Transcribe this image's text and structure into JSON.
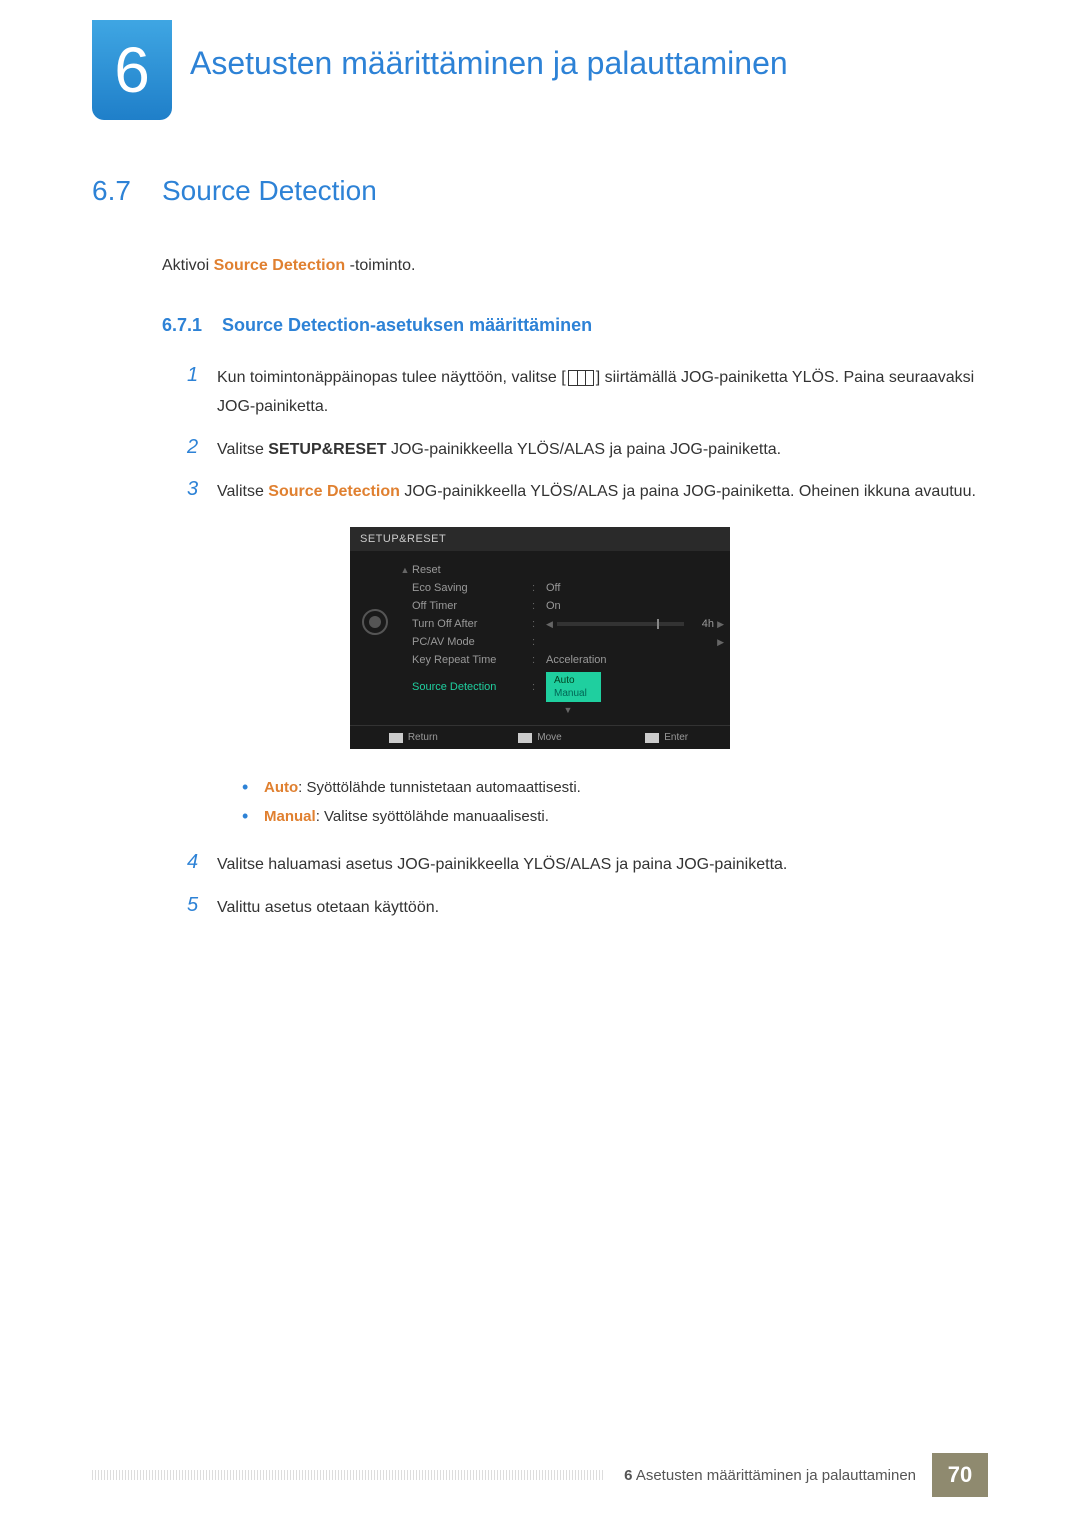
{
  "header": {
    "chapter_number": "6",
    "chapter_title": "Asetusten määrittäminen ja palauttaminen"
  },
  "section": {
    "number": "6.7",
    "title": "Source Detection",
    "intro_prefix": "Aktivoi ",
    "intro_bold": "Source Detection",
    "intro_suffix": " -toiminto."
  },
  "subsection": {
    "number": "6.7.1",
    "title": "Source Detection-asetuksen määrittäminen"
  },
  "steps": {
    "s1": {
      "num": "1",
      "t1": "Kun toimintonäppäinopas tulee näyttöön, valitse [",
      "t2": "] siirtämällä JOG-painiketta YLÖS. Paina seuraavaksi JOG-painiketta."
    },
    "s2": {
      "num": "2",
      "t1": "Valitse ",
      "b1": "SETUP&RESET",
      "t2": " JOG-painikkeella YLÖS/ALAS ja paina JOG-painiketta."
    },
    "s3": {
      "num": "3",
      "t1": "Valitse ",
      "b1": "Source Detection",
      "t2": " JOG-painikkeella YLÖS/ALAS ja paina JOG-painiketta. Oheinen ikkuna avautuu."
    },
    "s4": {
      "num": "4",
      "t": "Valitse haluamasi asetus JOG-painikkeella YLÖS/ALAS ja paina JOG-painiketta."
    },
    "s5": {
      "num": "5",
      "t": "Valittu asetus otetaan käyttöön."
    }
  },
  "osd": {
    "title": "SETUP&RESET",
    "rows": {
      "reset": "Reset",
      "eco": "Eco Saving",
      "eco_val": "Off",
      "timer": "Off Timer",
      "timer_val": "On",
      "turnoff": "Turn Off After",
      "turnoff_val": "4h",
      "pcav": "PC/AV Mode",
      "repeat": "Key Repeat Time",
      "repeat_val": "Acceleration",
      "source": "Source Detection",
      "source_auto": "Auto",
      "source_manual": "Manual"
    },
    "footer": {
      "return": "Return",
      "move": "Move",
      "enter": "Enter"
    }
  },
  "bullets": {
    "b1_label": "Auto",
    "b1_text": ": Syöttölähde tunnistetaan automaattisesti.",
    "b2_label": "Manual",
    "b2_text": ": Valitse syöttölähde manuaalisesti."
  },
  "footer": {
    "chapter_num": "6",
    "chapter_text": " Asetusten määrittäminen ja palauttaminen",
    "page": "70"
  }
}
